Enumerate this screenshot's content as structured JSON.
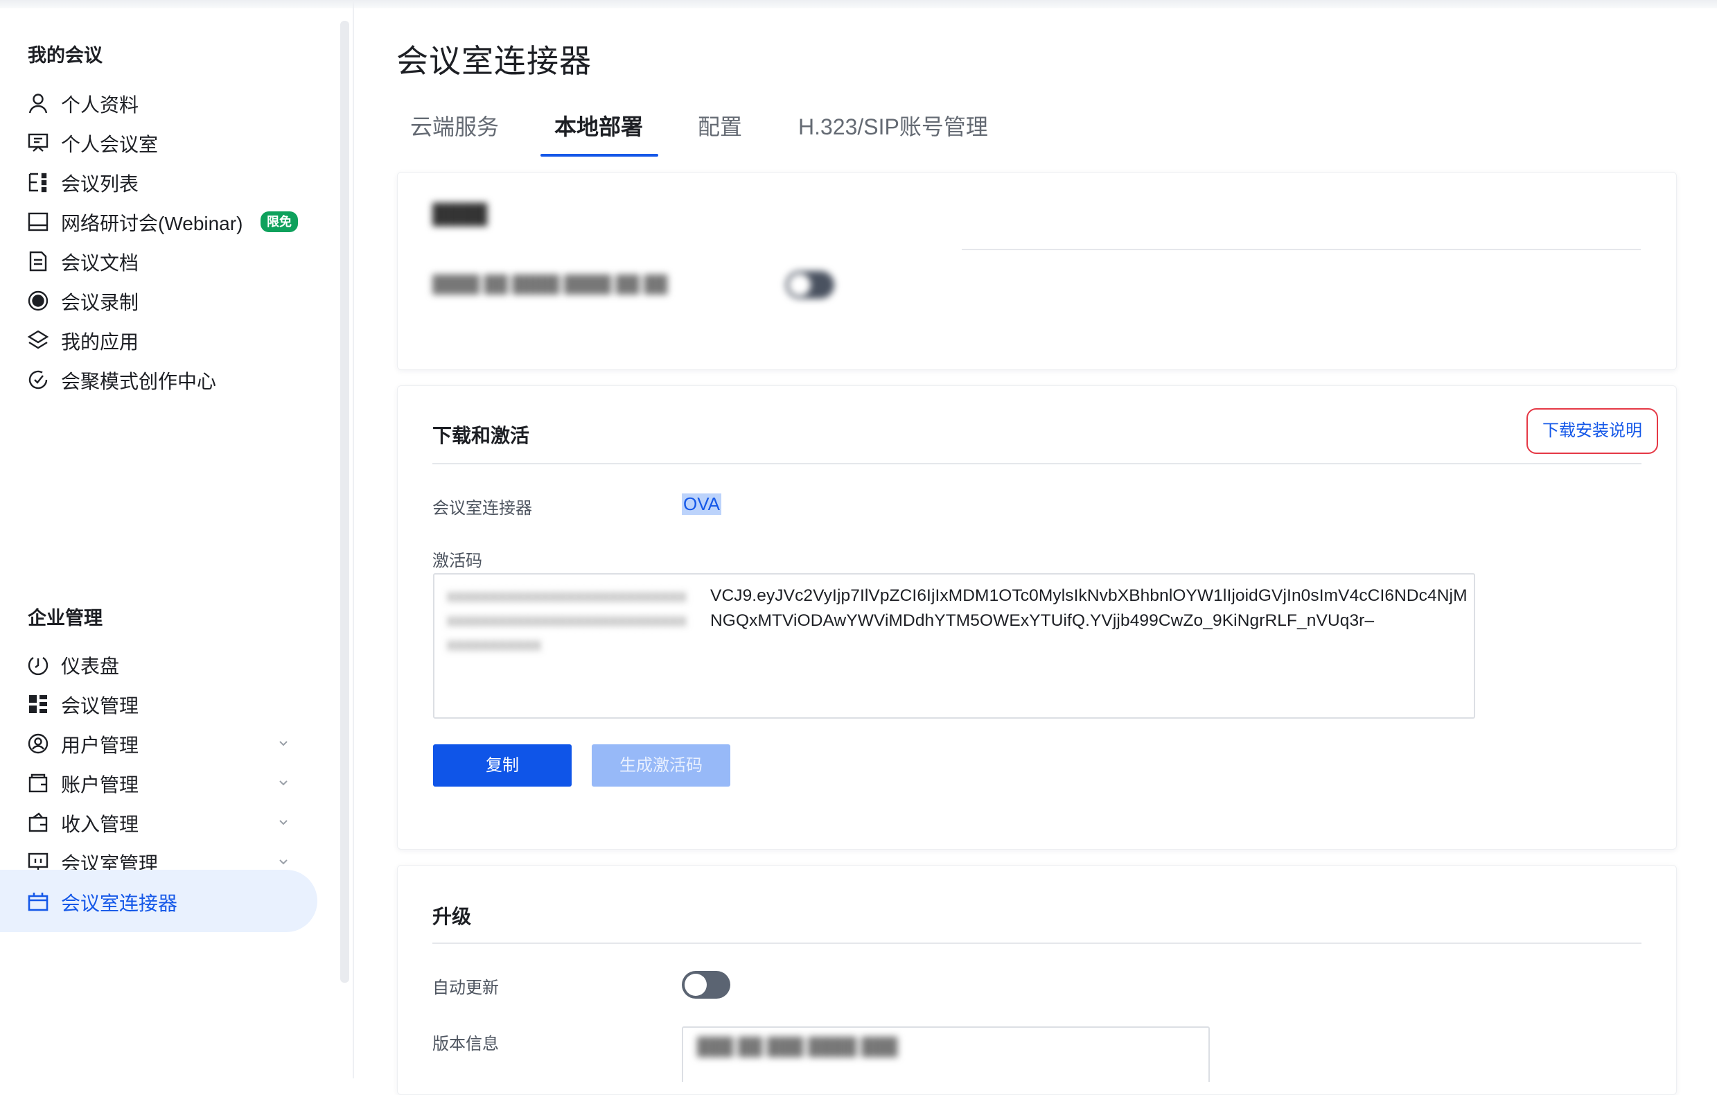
{
  "sidebar": {
    "section_my": "我的会议",
    "section_enterprise": "企业管理",
    "items_my": [
      {
        "label": "个人资料",
        "icon": "user-icon"
      },
      {
        "label": "个人会议室",
        "icon": "presentation-board-icon"
      },
      {
        "label": "会议列表",
        "icon": "meeting-list-icon"
      },
      {
        "label": "网络研讨会(Webinar)",
        "icon": "monitor-icon",
        "badge": "限免"
      },
      {
        "label": "会议文档",
        "icon": "document-icon"
      },
      {
        "label": "会议录制",
        "icon": "record-icon"
      },
      {
        "label": "我的应用",
        "icon": "layers-icon"
      },
      {
        "label": "会聚模式创作中心",
        "icon": "sparkle-circle-icon"
      }
    ],
    "items_enterprise": [
      {
        "label": "仪表盘",
        "icon": "gauge-icon"
      },
      {
        "label": "会议管理",
        "icon": "grid-icon"
      },
      {
        "label": "用户管理",
        "icon": "user-circle-icon",
        "expandable": true
      },
      {
        "label": "账户管理",
        "icon": "wallet-icon",
        "expandable": true
      },
      {
        "label": "收入管理",
        "icon": "revenue-icon",
        "expandable": true
      },
      {
        "label": "会议室管理",
        "icon": "room-icon",
        "expandable": true
      },
      {
        "label": "会议室连接器",
        "icon": "connector-icon",
        "active": true
      }
    ]
  },
  "main": {
    "title": "会议室连接器",
    "tabs": [
      {
        "label": "云端服务"
      },
      {
        "label": "本地部署",
        "active": true
      },
      {
        "label": "配置"
      },
      {
        "label": "H.323/SIP账号管理"
      }
    ],
    "blurred_card": {
      "title": "████",
      "row_label": "████ ██ ████ ████ ██ ██"
    },
    "download_card": {
      "title": "下载和激活",
      "install_link": "下载安装说明",
      "connector_label": "会议室连接器",
      "connector_value": "OVA",
      "activation_label": "激活码",
      "code_visible_line1": "VCJ9.eyJVc2VyIjp7IlVpZCI6IjIxMDM1OTc0MylsIkNvbXBhbnlOYW1lIjoidGVjIn0sImV4cCI6NDc4NjM",
      "code_visible_line2": "NGQxMTViODAwYWViMDdhYTM5OWExYTUifQ.YVjjb499CwZo_9KiNgrRLF_nVUq3r–",
      "code_blurred_line1": "xxxxxxxxxxxxxxxxxxxxxxxxxxxx",
      "code_blurred_line2": "xxxxxxxxxxxxxxxxxxxxxxxxxxxx",
      "code_blurred_line3": "xxxxxxxxxxx",
      "copy_button": "复制",
      "generate_button": "生成激活码"
    },
    "upgrade_card": {
      "title": "升级",
      "auto_update_label": "自动更新",
      "auto_update_on": false,
      "version_label": "版本信息",
      "version_value": "███ ██ ███ ████ ███"
    }
  },
  "colors": {
    "accent": "#1558e8",
    "active_bg": "#e9f1fe",
    "badge": "#0ea15c",
    "highlight_border": "#e53946"
  }
}
